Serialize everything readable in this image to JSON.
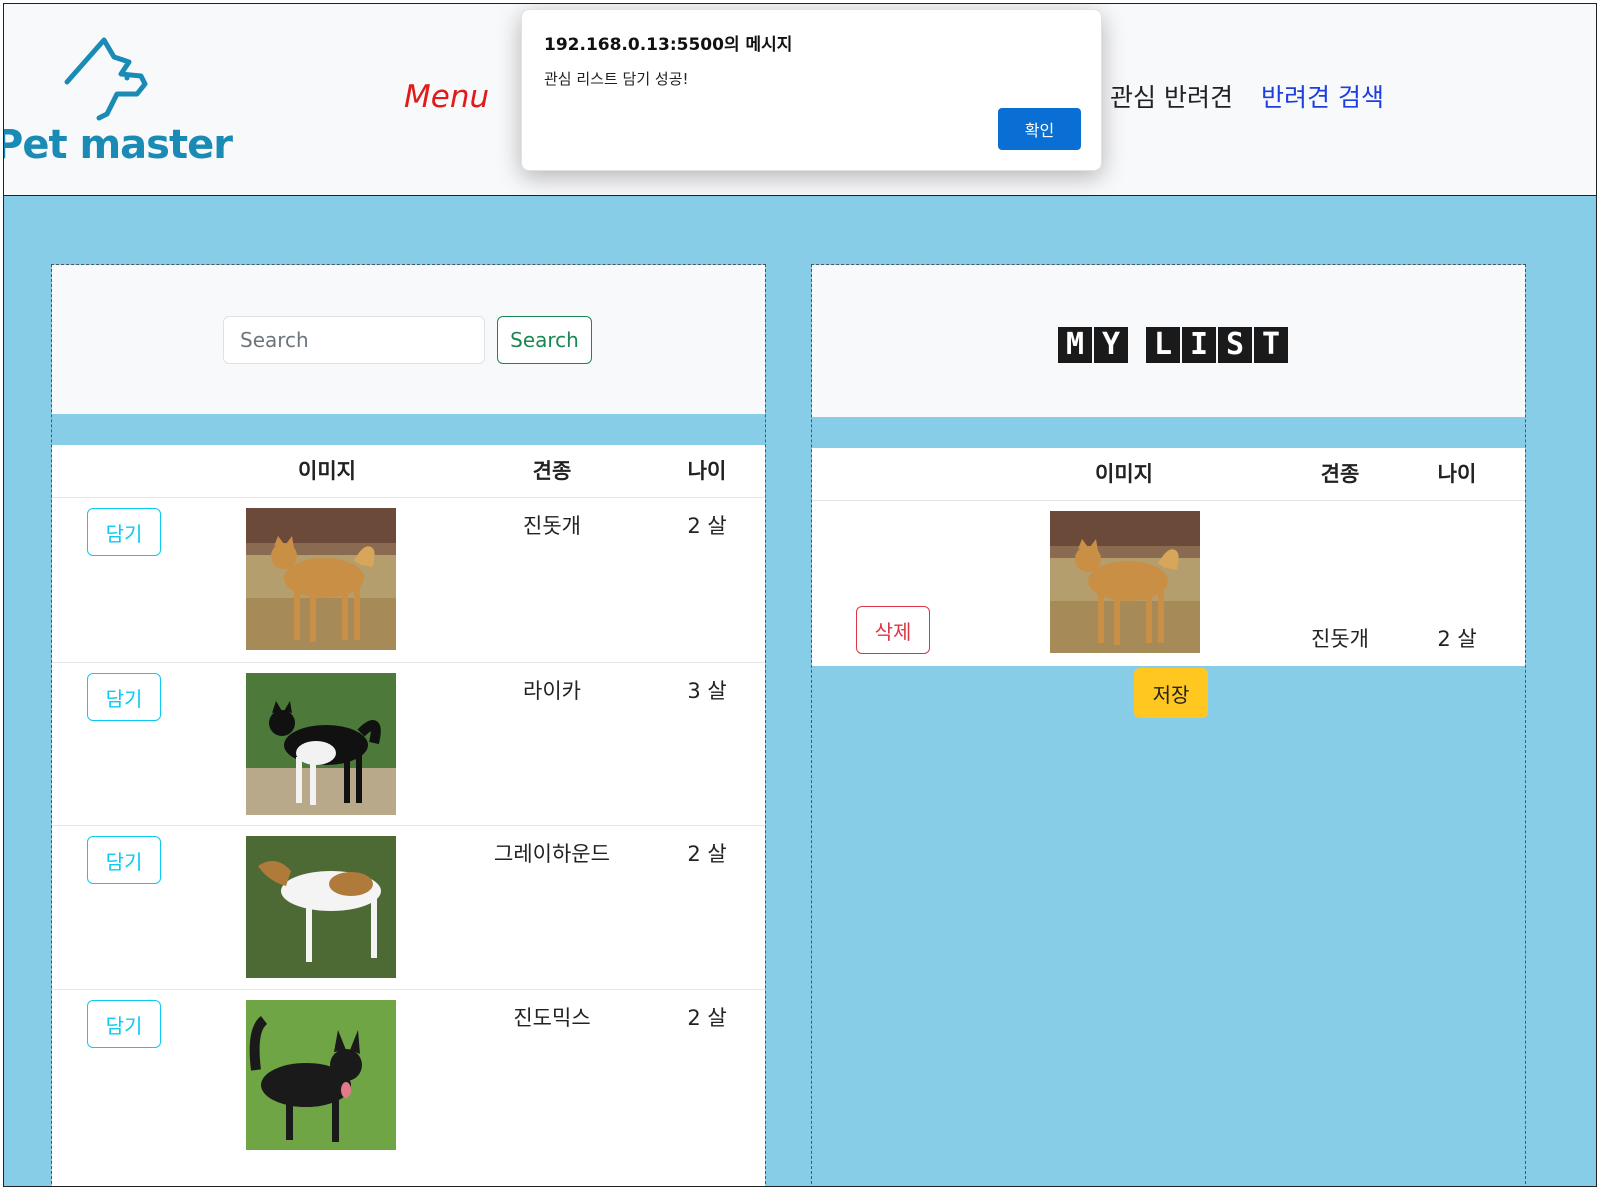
{
  "header": {
    "logo_text": "Pet master",
    "menu_label": "Menu",
    "nav_favorites": "관심 반려견",
    "nav_search": "반려견 검색",
    "menu_color": "#e01b1b",
    "nav_search_color": "#1e3ee0"
  },
  "search": {
    "placeholder": "Search",
    "button_label": "Search"
  },
  "left_table": {
    "headers": {
      "image": "이미지",
      "breed": "견종",
      "age": "나이"
    },
    "rows": [
      {
        "button": "담기",
        "breed": "진돗개",
        "age": "2 살",
        "image": "shiba-yellow-dog"
      },
      {
        "button": "담기",
        "breed": "라이카",
        "age": "3 살",
        "image": "black-white-dog"
      },
      {
        "button": "담기",
        "breed": "그레이하운드",
        "age": "2 살",
        "image": "greyhound-dog"
      },
      {
        "button": "담기",
        "breed": "진도믹스",
        "age": "2 살",
        "image": "black-dog"
      }
    ]
  },
  "mylist": {
    "title_letters": [
      "M",
      "Y",
      " ",
      "L",
      "I",
      "S",
      "T"
    ],
    "headers": {
      "image": "이미지",
      "breed": "견종",
      "age": "나이"
    },
    "rows": [
      {
        "button": "삭제",
        "breed": "진돗개",
        "age": "2 살",
        "image": "shiba-yellow-dog"
      }
    ],
    "save_button": "저장"
  },
  "dialog": {
    "title": "192.168.0.13:5500의 메시지",
    "message": "관심 리스트 담기 성공!",
    "ok_button": "확인"
  },
  "colors": {
    "background": "#87cde8",
    "add_button": "#0dcaf0",
    "delete_button": "#dc3545",
    "save_button": "#ffc720",
    "search_button": "#198754",
    "dialog_ok": "#0a6fd4",
    "logo": "#1a8bb5"
  }
}
